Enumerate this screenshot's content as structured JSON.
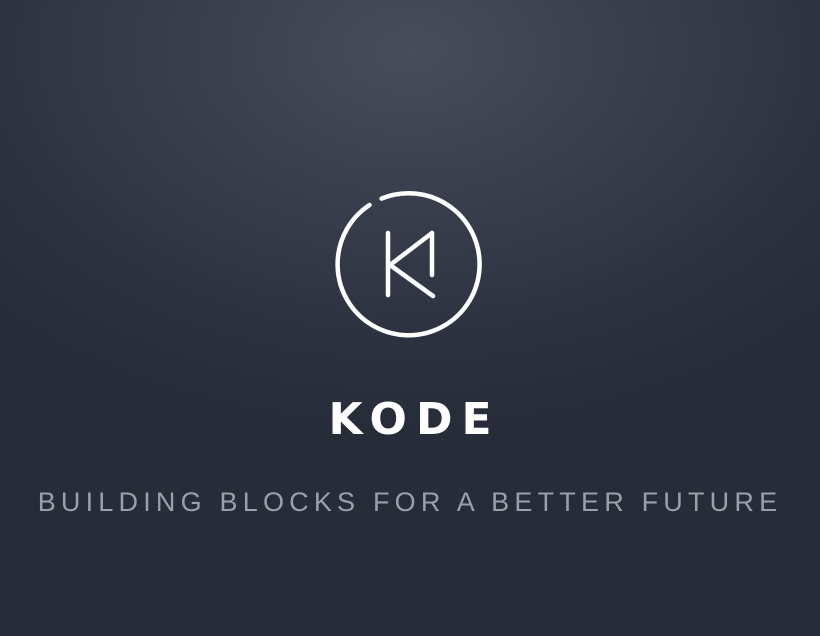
{
  "hero": {
    "logo": {
      "icon": "kode-k-circle-logo-icon"
    },
    "brand_name": "KODE",
    "tagline": "BUILDING BLOCKS FOR A BETTER FUTURE"
  },
  "colors": {
    "background": "#2f3542",
    "brand_text": "#ffffff",
    "tagline_text": "#9aa0ab",
    "logo_stroke": "#ffffff"
  }
}
